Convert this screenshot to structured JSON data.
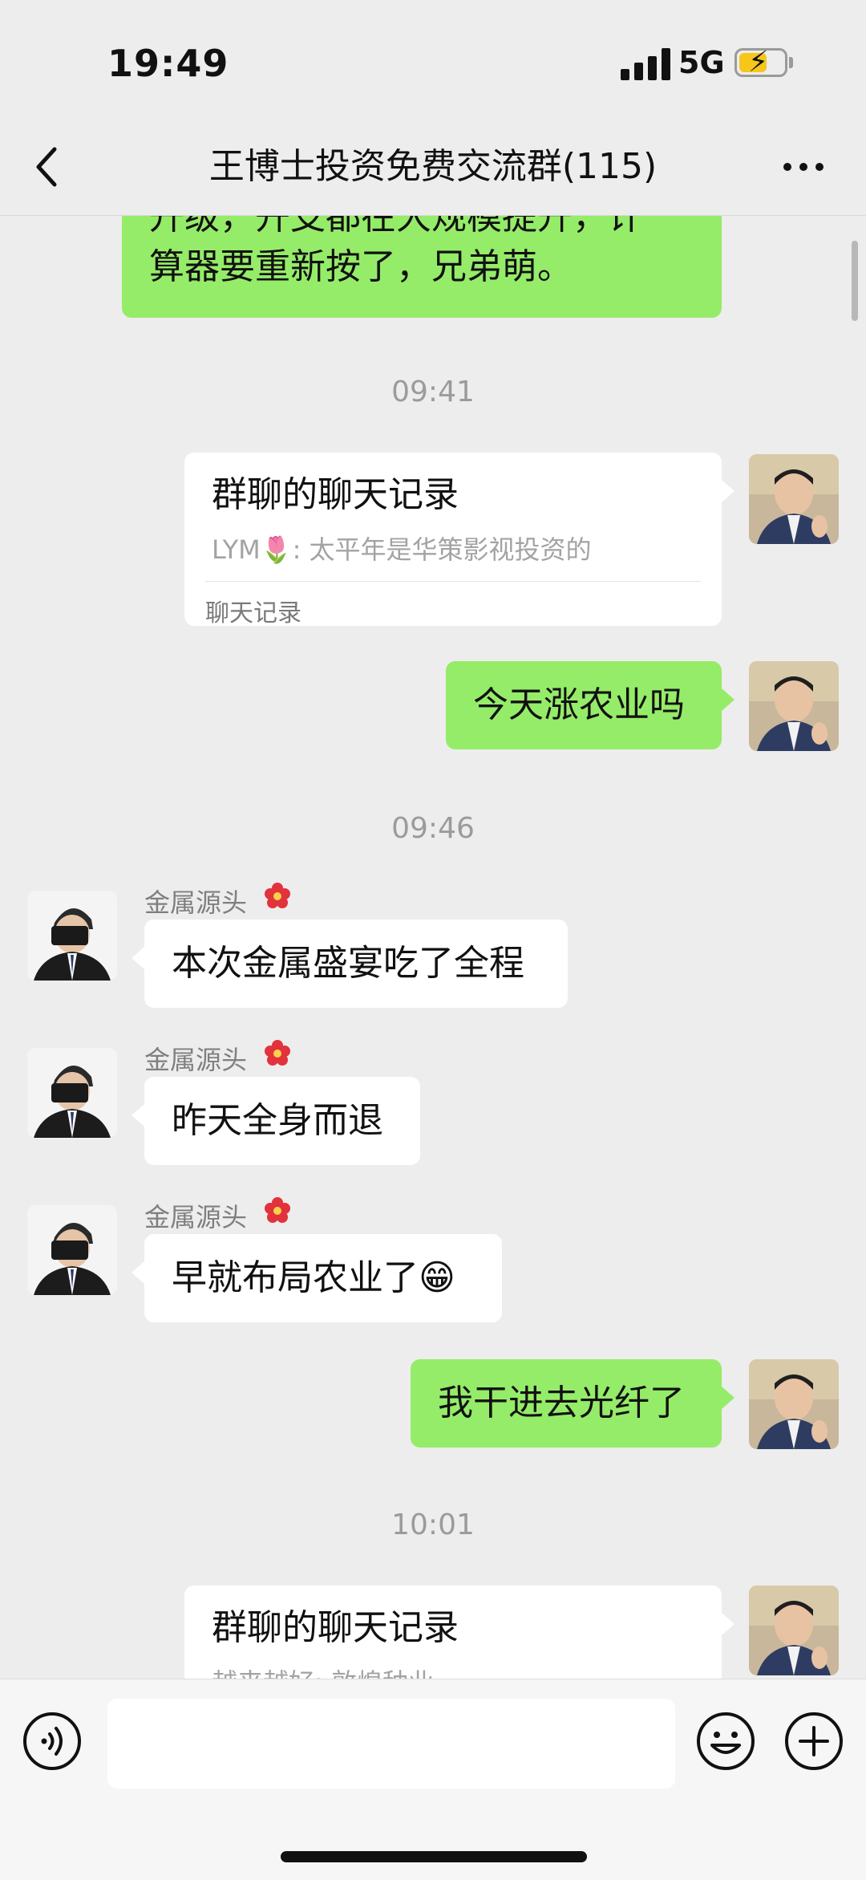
{
  "status_bar": {
    "time": "19:49",
    "network": "5G",
    "battery_icon": "battery-charging-icon",
    "battery_color": "#f6c71a"
  },
  "header": {
    "title": "王博士投资免费交流群(115)",
    "back_icon": "chevron-left-icon",
    "more_icon": "more-dots-icon"
  },
  "messages": {
    "m0": {
      "text_line1": "升级，开支都在大规模提升，计",
      "text_line2": "算器要重新按了，兄弟萌。"
    },
    "t1": "09:41",
    "m1": {
      "title": "群聊的聊天记录",
      "preview": "LYM🌷: 太平年是华策影视投资的",
      "footer": "聊天记录"
    },
    "m2": {
      "text": "今天涨农业吗"
    },
    "t2": "09:46",
    "m3": {
      "sender": "金属源头",
      "text": "本次金属盛宴吃了全程"
    },
    "m4": {
      "sender": "金属源头",
      "text": "昨天全身而退"
    },
    "m5": {
      "sender": "金属源头",
      "text": "早就布局农业了😁"
    },
    "m6": {
      "text": "我干进去光纤了"
    },
    "t3": "10:01",
    "m7": {
      "title": "群聊的聊天记录",
      "preview": "越来越好: 敦煌种业"
    }
  },
  "input_bar": {
    "voice_icon": "voice-mode-icon",
    "emoji_icon": "emoji-icon",
    "plus_icon": "plus-icon",
    "input_value": ""
  },
  "colors": {
    "self_bubble": "#95ec69",
    "other_bubble": "#ffffff",
    "background": "#ededed"
  }
}
